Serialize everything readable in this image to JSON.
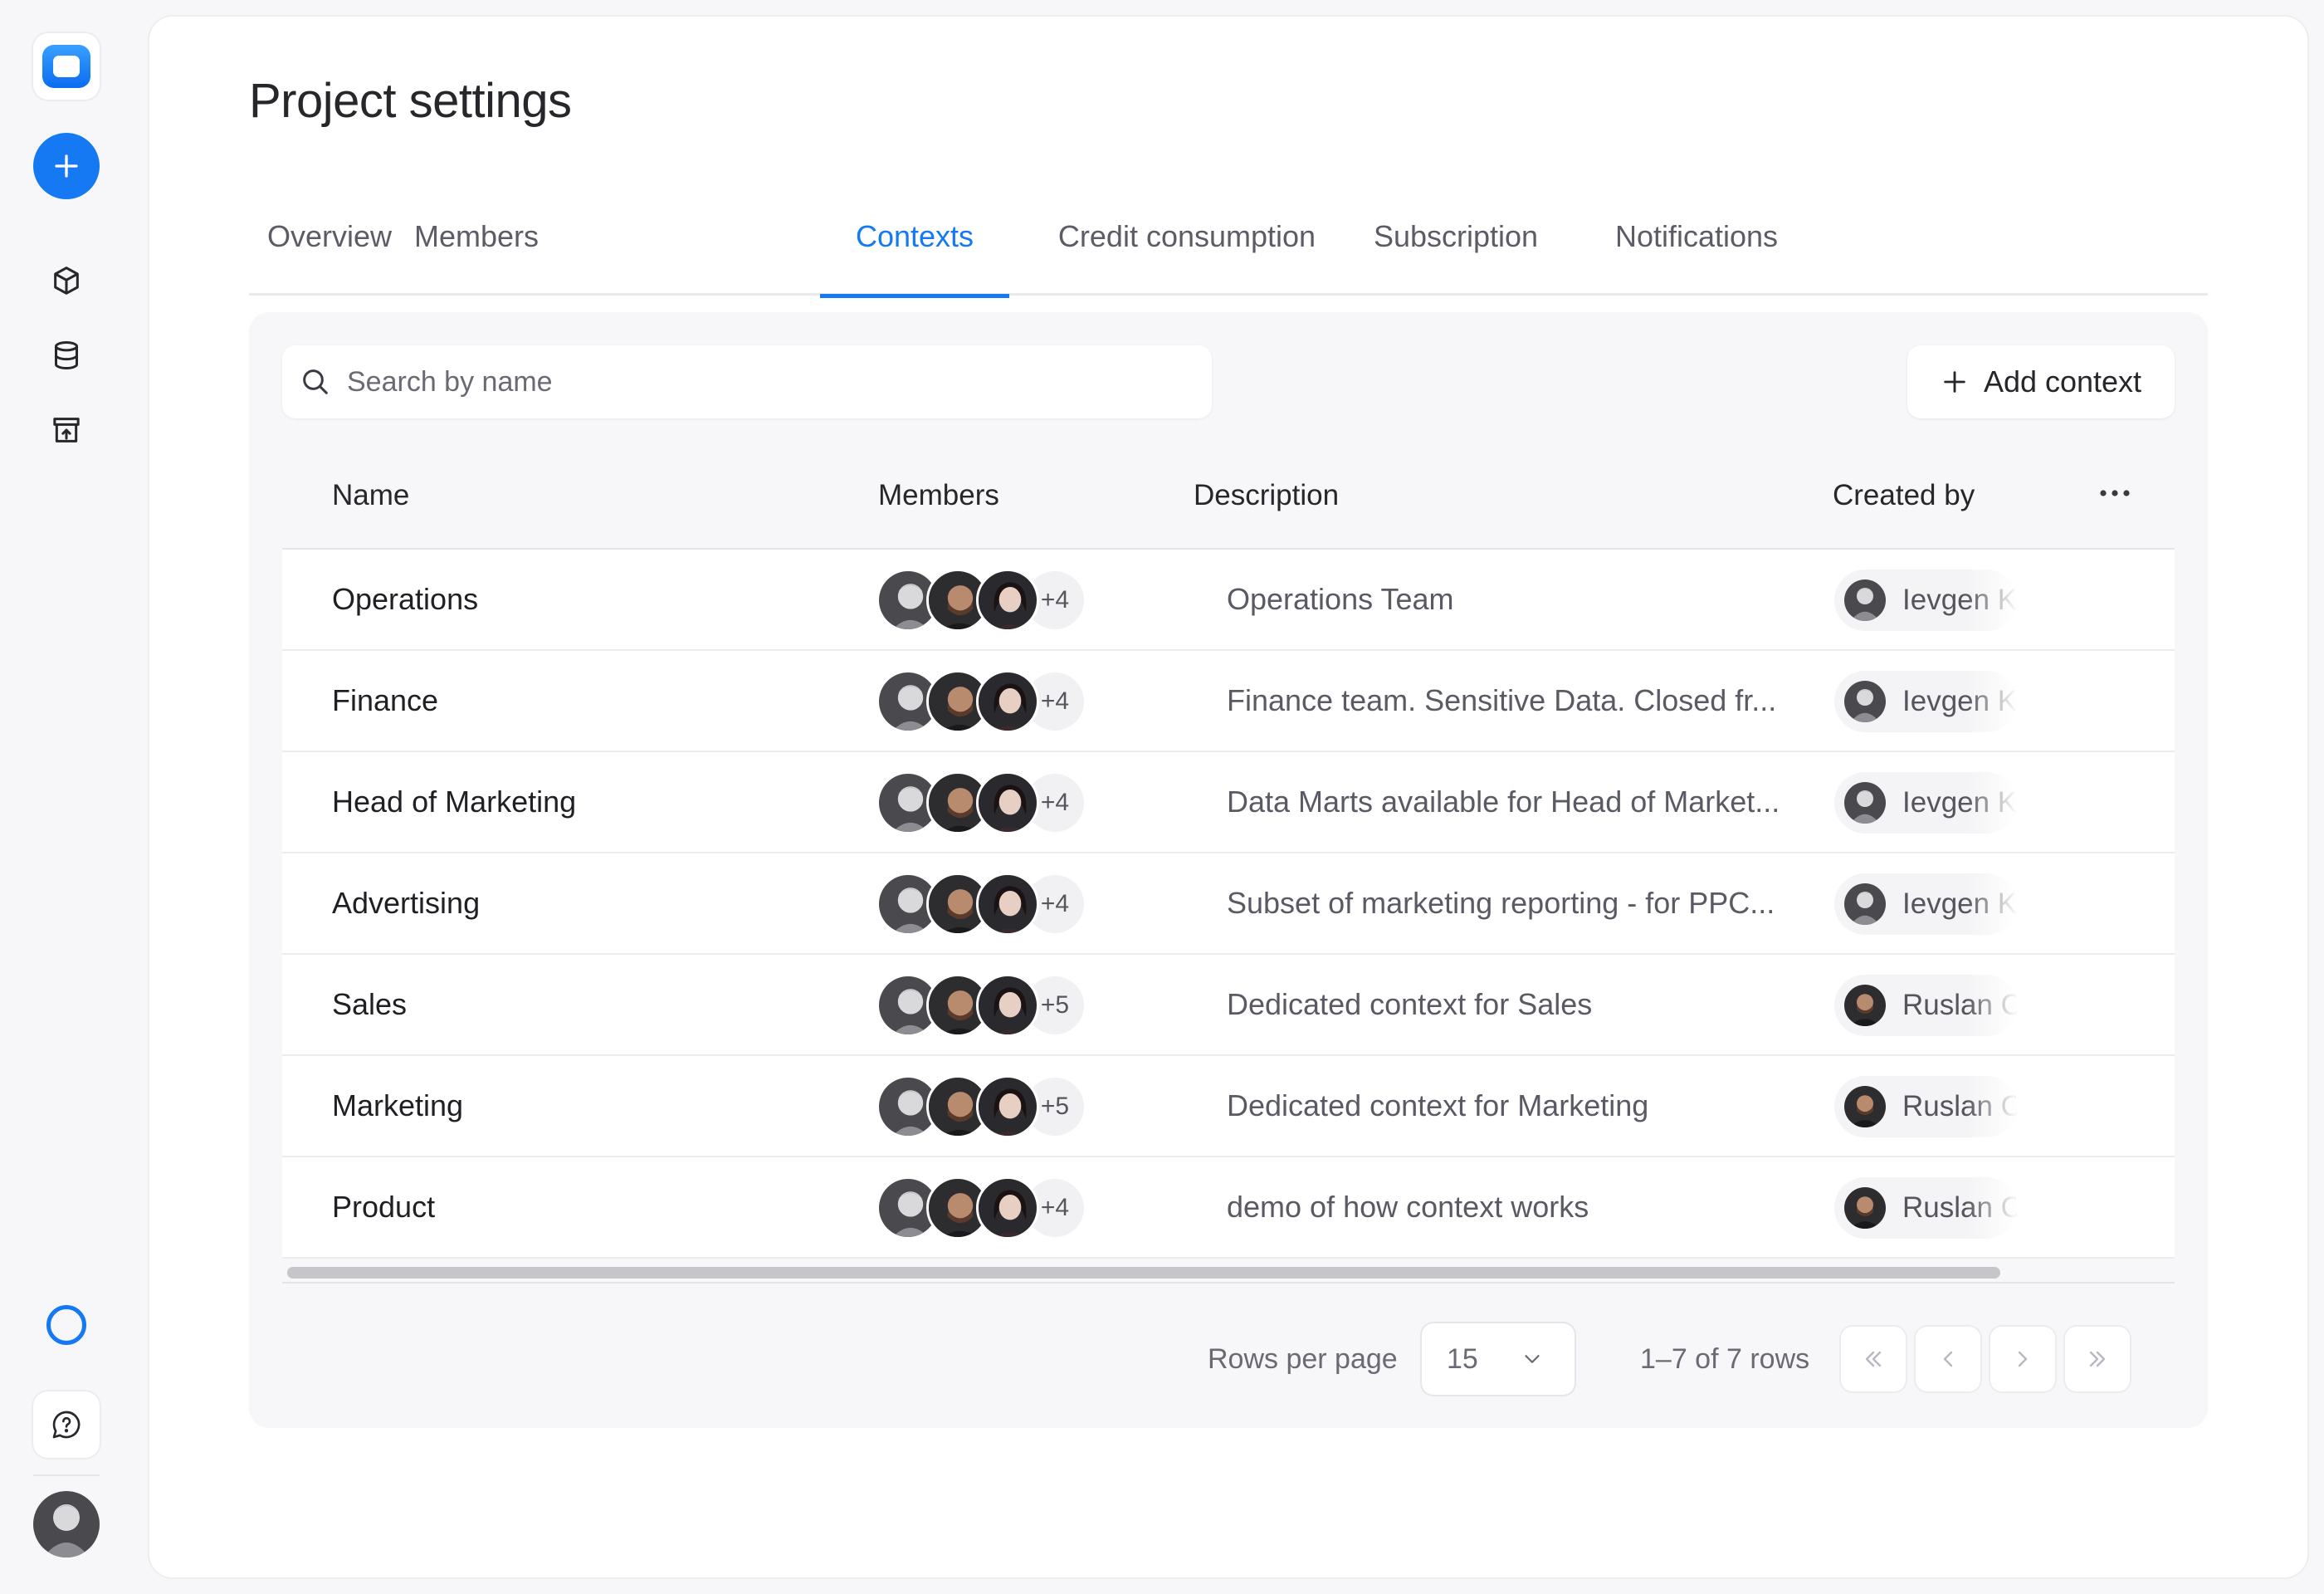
{
  "page_title": "Project settings",
  "tabs": [
    {
      "label": "Overview"
    },
    {
      "label": "Members"
    },
    {
      "label": "Contexts"
    },
    {
      "label": "Credit consumption"
    },
    {
      "label": "Subscription"
    },
    {
      "label": "Notifications"
    }
  ],
  "active_tab": "Contexts",
  "search": {
    "placeholder": "Search by name",
    "value": ""
  },
  "add_button": {
    "label": "Add context"
  },
  "table": {
    "columns": [
      "Name",
      "Members",
      "Description",
      "Created by"
    ],
    "rows": [
      {
        "name": "Operations",
        "extra_members": "+4",
        "description": "Operations Team",
        "created_by": "Ievgen K"
      },
      {
        "name": "Finance",
        "extra_members": "+4",
        "description": "Finance team. Sensitive Data. Closed fr...",
        "created_by": "Ievgen K"
      },
      {
        "name": "Head of Marketing",
        "extra_members": "+4",
        "description": "Data Marts available for Head of Market...",
        "created_by": "Ievgen K"
      },
      {
        "name": "Advertising",
        "extra_members": "+4",
        "description": "Subset of marketing reporting - for PPC...",
        "created_by": "Ievgen K"
      },
      {
        "name": "Sales",
        "extra_members": "+5",
        "description": "Dedicated context for Sales",
        "created_by": "Ruslan C"
      },
      {
        "name": "Marketing",
        "extra_members": "+5",
        "description": "Dedicated context for Marketing",
        "created_by": "Ruslan C"
      },
      {
        "name": "Product",
        "extra_members": "+4",
        "description": "demo of how context works",
        "created_by": "Ruslan C"
      }
    ]
  },
  "pagination": {
    "rows_per_page_label": "Rows per page",
    "rows_per_page_value": "15",
    "range_text": "1–7 of 7 rows"
  },
  "colors": {
    "accent": "#1479f3",
    "text": "#26262b",
    "muted": "#5a5a64",
    "panel_bg": "#f7f7f9"
  },
  "icons": {
    "rail": [
      "app-logo-icon",
      "plus-icon",
      "cube-icon",
      "database-icon",
      "archive-icon",
      "status-ring-icon",
      "help-chat-icon"
    ],
    "search": "search-icon",
    "add": "plus-icon",
    "column_menu": "more-horizontal-icon",
    "pagination": [
      "first-page-icon",
      "prev-page-icon",
      "next-page-icon",
      "last-page-icon"
    ]
  }
}
